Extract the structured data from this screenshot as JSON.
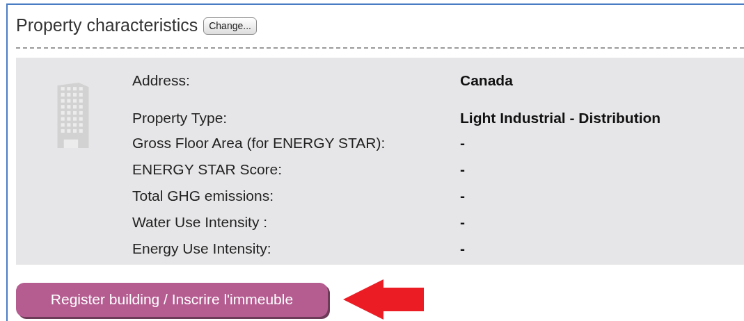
{
  "section": {
    "title": "Property characteristics",
    "change_button": "Change..."
  },
  "details": [
    {
      "label": "Address:",
      "value": "Canada"
    },
    {
      "label": "Property Type:",
      "value": "Light Industrial - Distribution"
    },
    {
      "label": "Gross Floor Area (for ENERGY STAR):",
      "value": "-"
    },
    {
      "label": "ENERGY STAR Score:",
      "value": "-"
    },
    {
      "label": "Total GHG emissions:",
      "value": "-"
    },
    {
      "label": "Water Use Intensity :",
      "value": "-"
    },
    {
      "label": "Energy Use Intensity:",
      "value": "-"
    }
  ],
  "register_button": "Register building / Inscrire l'immeuble"
}
